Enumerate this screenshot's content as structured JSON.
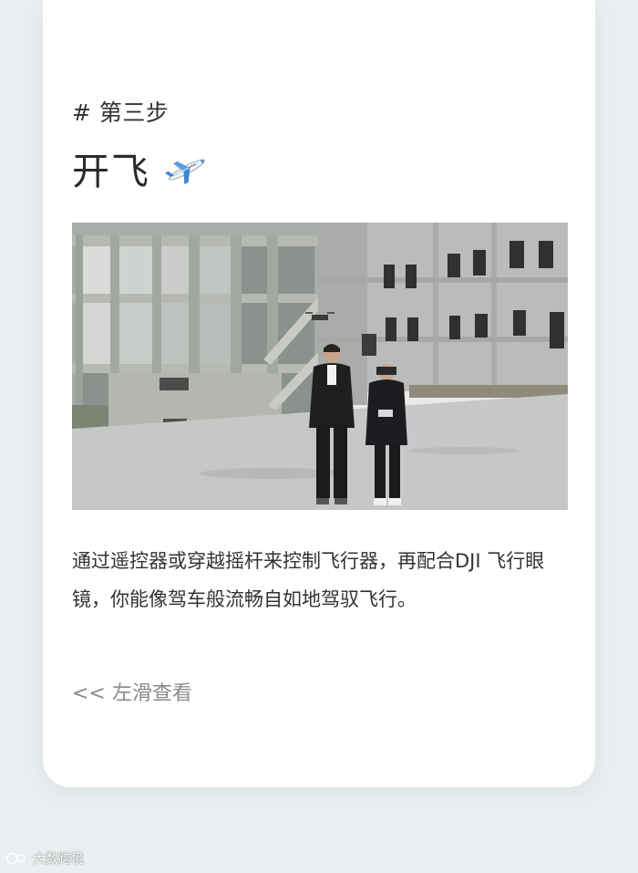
{
  "card": {
    "step_label": "# 第三步",
    "title": "开飞",
    "description": "通过遥控器或穿越摇杆来控制飞行器，再配合DJI 飞行眼镜，你能像驾车般流畅自如地驾驭飞行。",
    "hint": "<< 左滑查看"
  },
  "icons": {
    "title_icon": "airplane-icon"
  },
  "watermark": {
    "text": "大数跨境",
    "logo": "C"
  },
  "colors": {
    "background": "#e9eff0",
    "card": "#ffffff",
    "text": "#333333",
    "hint": "#8a8a8a"
  }
}
